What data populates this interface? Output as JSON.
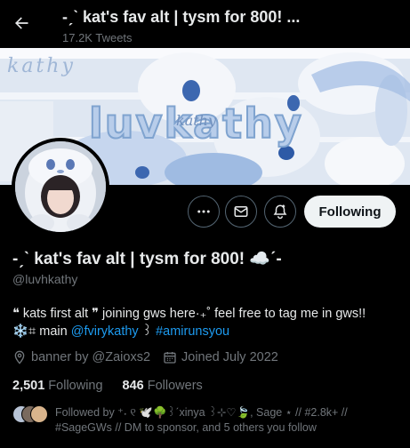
{
  "header": {
    "title": "-ˏˋ kat's fav alt | tysm for 800! ...",
    "tweets_count": "17.2K Tweets"
  },
  "banner": {
    "script_text": "kathy",
    "big_text": "luvkathy",
    "overlay_text": "kathy"
  },
  "profile": {
    "display_name": "-ˏˋ kat's fav alt | tysm for 800! ☁️ˊ-",
    "handle": "@luvhkathy",
    "bio_line1": "❝ kats first alt ❞ joining gws here·₊˚ feel free to tag me in gws!!",
    "bio_line2_prefix": "❄️⌗ main ",
    "bio_mention": "@fvirykathy",
    "bio_sep": " ꒱ ",
    "bio_hashtag": "#amirunsyou",
    "location": "banner by @Zaioxs2",
    "joined": "Joined July 2022",
    "following_count": "2,501",
    "following_label": "Following",
    "followers_count": "846",
    "followers_label": "Followers",
    "followed_by": "Followed by ⁺˖ ୧ 🕊️🌳꒱ˊxinya ꒱⊹♡🍃, Sage ⋆ // #2.8k+ // #SageGWs // DM to sponsor, and 5 others you follow"
  },
  "actions": {
    "following_button": "Following"
  },
  "icons": [
    "back-arrow-icon",
    "more-icon",
    "message-icon",
    "notification-bell-icon",
    "location-icon",
    "calendar-icon"
  ],
  "colors": {
    "background": "#000000",
    "text": "#e7e9ea",
    "muted": "#71767b",
    "link": "#1d9bf0",
    "button": "#eff3f4"
  }
}
